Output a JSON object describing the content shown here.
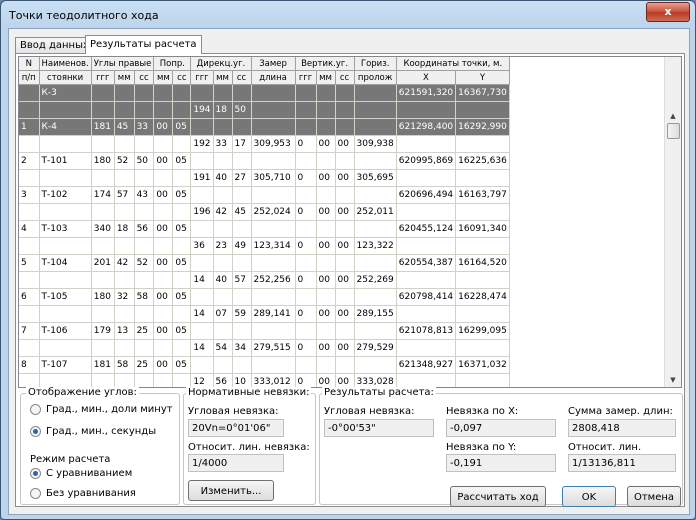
{
  "window": {
    "title": "Точки теодолитного хода",
    "close": "x"
  },
  "tabs": [
    {
      "label": "Ввод данных"
    },
    {
      "label": "Результаты расчета"
    }
  ],
  "grid": {
    "header1": [
      "N",
      "Наименов.",
      "Углы правые",
      "Попр.",
      "Дирекц.уг.",
      "Замер",
      "Вертик.уг.",
      "Гориз.",
      "Координаты точки, м."
    ],
    "header2": [
      "п/п",
      "стоянки",
      "ггг",
      "мм",
      "сс",
      "мм",
      "сс",
      "ггг",
      "мм",
      "сс",
      "длина",
      "ггг",
      "мм",
      "сс",
      "пролож",
      "X",
      "Y"
    ],
    "rows": [
      [
        "",
        "К-3",
        "",
        "",
        "",
        "",
        "",
        "",
        "",
        "",
        "",
        "",
        "",
        "",
        "",
        "621591,320",
        "16367,730"
      ],
      [
        "",
        "",
        "",
        "",
        "",
        "",
        "",
        "194",
        "18",
        "50",
        "",
        "",
        "",
        "",
        "",
        "",
        ""
      ],
      [
        "1",
        "К-4",
        "181",
        "45",
        "33",
        "00",
        "05",
        "",
        "",
        "",
        "",
        "",
        "",
        "",
        "",
        "621298,400",
        "16292,990"
      ],
      [
        "",
        "",
        "",
        "",
        "",
        "",
        "",
        "192",
        "33",
        "17",
        "309,953",
        "0",
        "00",
        "00",
        "309,938",
        "",
        ""
      ],
      [
        "2",
        "Т-101",
        "180",
        "52",
        "50",
        "00",
        "05",
        "",
        "",
        "",
        "",
        "",
        "",
        "",
        "",
        "620995,869",
        "16225,636"
      ],
      [
        "",
        "",
        "",
        "",
        "",
        "",
        "",
        "191",
        "40",
        "27",
        "305,710",
        "0",
        "00",
        "00",
        "305,695",
        "",
        ""
      ],
      [
        "3",
        "Т-102",
        "174",
        "57",
        "43",
        "00",
        "05",
        "",
        "",
        "",
        "",
        "",
        "",
        "",
        "",
        "620696,494",
        "16163,797"
      ],
      [
        "",
        "",
        "",
        "",
        "",
        "",
        "",
        "196",
        "42",
        "45",
        "252,024",
        "0",
        "00",
        "00",
        "252,011",
        "",
        ""
      ],
      [
        "4",
        "Т-103",
        "340",
        "18",
        "56",
        "00",
        "05",
        "",
        "",
        "",
        "",
        "",
        "",
        "",
        "",
        "620455,124",
        "16091,340"
      ],
      [
        "",
        "",
        "",
        "",
        "",
        "",
        "",
        "36",
        "23",
        "49",
        "123,314",
        "0",
        "00",
        "00",
        "123,322",
        "",
        ""
      ],
      [
        "5",
        "Т-104",
        "201",
        "42",
        "52",
        "00",
        "05",
        "",
        "",
        "",
        "",
        "",
        "",
        "",
        "",
        "620554,387",
        "16164,520"
      ],
      [
        "",
        "",
        "",
        "",
        "",
        "",
        "",
        "14",
        "40",
        "57",
        "252,256",
        "0",
        "00",
        "00",
        "252,269",
        "",
        ""
      ],
      [
        "6",
        "Т-105",
        "180",
        "32",
        "58",
        "00",
        "05",
        "",
        "",
        "",
        "",
        "",
        "",
        "",
        "",
        "620798,414",
        "16228,474"
      ],
      [
        "",
        "",
        "",
        "",
        "",
        "",
        "",
        "14",
        "07",
        "59",
        "289,141",
        "0",
        "00",
        "00",
        "289,155",
        "",
        ""
      ],
      [
        "7",
        "Т-106",
        "179",
        "13",
        "25",
        "00",
        "05",
        "",
        "",
        "",
        "",
        "",
        "",
        "",
        "",
        "621078,813",
        "16299,095"
      ],
      [
        "",
        "",
        "",
        "",
        "",
        "",
        "",
        "14",
        "54",
        "34",
        "279,515",
        "0",
        "00",
        "00",
        "279,529",
        "",
        ""
      ],
      [
        "8",
        "Т-107",
        "181",
        "58",
        "25",
        "00",
        "05",
        "",
        "",
        "",
        "",
        "",
        "",
        "",
        "",
        "621348,927",
        "16371,032"
      ],
      [
        "",
        "",
        "",
        "",
        "",
        "",
        "",
        "12",
        "56",
        "10",
        "333,012",
        "0",
        "00",
        "00",
        "333,028",
        "",
        ""
      ]
    ]
  },
  "angles": {
    "group_label": "Отображение углов:",
    "opt1": "Град., мин., доли минут",
    "opt2": "Град., мин., секунды"
  },
  "mode": {
    "group_label": "Режим расчета",
    "opt1": "С уравниванием",
    "opt2": "Без уравнивания"
  },
  "norm": {
    "group_label": "Нормативные невязки:",
    "angle_label": "Угловая невязка:",
    "angle_value": "20Vn=0°01'06\"",
    "lin_label": "Относит. лин. невязка:",
    "lin_value": "1/4000",
    "change_button": "Изменить..."
  },
  "results": {
    "group_label": "Результаты расчета:",
    "angle_label": "Угловая невязка:",
    "angle_value": "-0°00'53\"",
    "dx_label": "Невязка по X:",
    "dx_value": "-0,097",
    "dy_label": "Невязка по Y:",
    "dy_value": "-0,191",
    "sum_label": "Сумма замер. длин:",
    "sum_value": "2808,418",
    "rel_label": "Относит. лин. невязка:",
    "rel_value": "1/13136,811"
  },
  "buttons": {
    "calc": "Рассчитать ход",
    "ok": "OK",
    "cancel": "Отмена"
  }
}
